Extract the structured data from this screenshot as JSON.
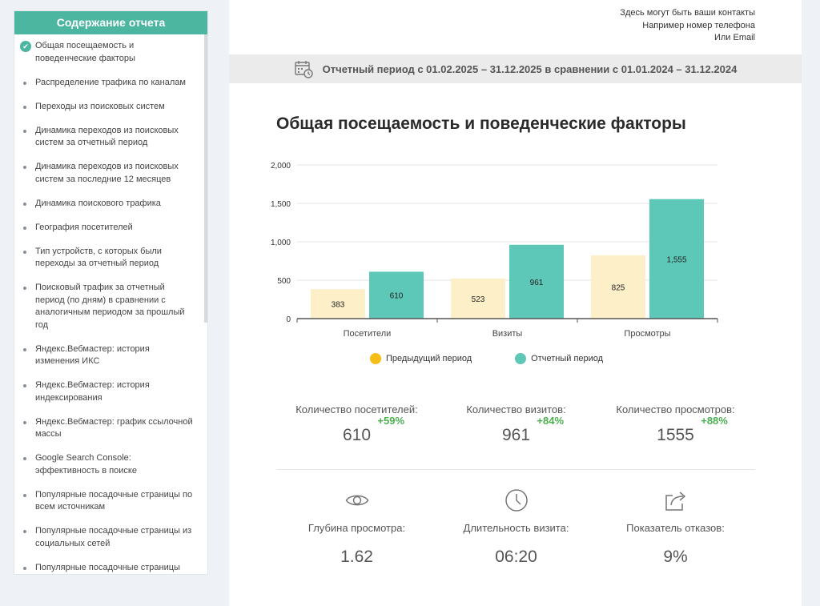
{
  "sidebar": {
    "title": "Содержание отчета",
    "items": [
      {
        "label": "Общая посещаемость и поведенческие факторы",
        "active": true
      },
      {
        "label": "Распределение трафика по каналам"
      },
      {
        "label": "Переходы из поисковых систем"
      },
      {
        "label": "Динамика переходов из поисковых систем за отчетный период"
      },
      {
        "label": "Динамика переходов из поисковых систем за последние 12 месяцев"
      },
      {
        "label": "Динамика поискового трафика"
      },
      {
        "label": "География посетителей"
      },
      {
        "label": "Тип устройств, с которых были переходы за отчетный период"
      },
      {
        "label": "Поисковый трафик за отчетный период (по дням) в сравнении с аналогичным периодом за прошлый год"
      },
      {
        "label": "Яндекс.Вебмастер: история изменения ИКС"
      },
      {
        "label": "Яндекс.Вебмастер: история индексирования"
      },
      {
        "label": "Яндекс.Вебмастер: график ссылочной массы"
      },
      {
        "label": "Google Search Console: эффективность в поиске"
      },
      {
        "label": "Популярные посадочные страницы по всем источникам"
      },
      {
        "label": "Популярные посадочные страницы из социальных сетей"
      },
      {
        "label": "Популярные посадочные страницы"
      }
    ]
  },
  "contacts": {
    "line1": "Здесь могут быть ваши контакты",
    "line2": "Например номер телефона",
    "line3": "Или Email"
  },
  "period": {
    "text": "Отчетный период с 01.02.2025 – 31.12.2025 в сравнении с 01.01.2024 – 31.12.2024",
    "icon": "calendar-clock-icon"
  },
  "report_title": "Общая посещаемость и поведенческие факторы",
  "colors": {
    "previous": "#fdefc8",
    "current": "#5ec8b8",
    "previous_legend": "#f6bd16",
    "current_legend": "#5ec8b8",
    "accent": "#4db6a0",
    "positive": "#4caf50"
  },
  "chart_data": {
    "type": "bar",
    "categories": [
      "Посетители",
      "Визиты",
      "Просмотры"
    ],
    "series": [
      {
        "name": "Предыдущий период",
        "values": [
          383,
          523,
          825
        ]
      },
      {
        "name": "Отчетный период",
        "values": [
          610,
          961,
          1555
        ]
      }
    ],
    "value_labels": {
      "previous": [
        "383",
        "523",
        "825"
      ],
      "current": [
        "610",
        "961",
        "1,555"
      ]
    },
    "yticks": [
      0,
      500,
      1000,
      1500,
      2000
    ],
    "ytick_labels": [
      "0",
      "500",
      "1,000",
      "1,500",
      "2,000"
    ],
    "ylim": [
      0,
      2000
    ],
    "grid": true,
    "legend_position": "bottom"
  },
  "stats": [
    {
      "label": "Количество посетителей:",
      "value": "610",
      "delta": "+59%"
    },
    {
      "label": "Количество визитов:",
      "value": "961",
      "delta": "+84%"
    },
    {
      "label": "Количество просмотров:",
      "value": "1555",
      "delta": "+88%"
    }
  ],
  "behavior": [
    {
      "label": "Глубина просмотра:",
      "value": "1.62",
      "icon": "eye-icon"
    },
    {
      "label": "Длительность визита:",
      "value": "06:20",
      "icon": "clock-icon"
    },
    {
      "label": "Показатель отказов:",
      "value": "9%",
      "icon": "share-exit-icon"
    }
  ]
}
